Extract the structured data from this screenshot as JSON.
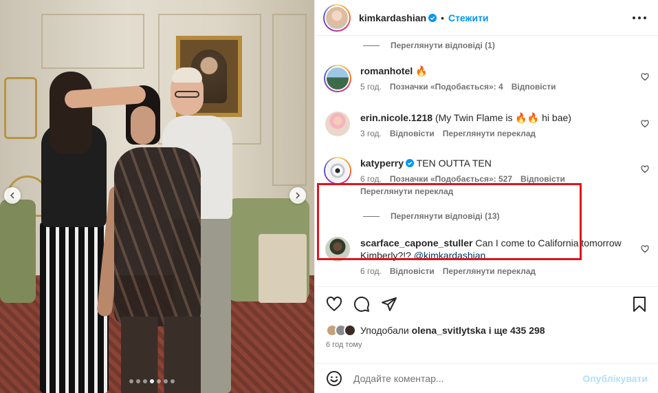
{
  "post": {
    "author": "kimkardashian",
    "separator": "•",
    "follow_label": "Стежити",
    "carousel": {
      "slide_count": 7,
      "active_index": 3
    }
  },
  "comments": {
    "top_replies": "Переглянути відповіді (1)",
    "items": [
      {
        "username": "romanhotel",
        "text": "🔥",
        "time": "5 год.",
        "likes": "Позначки «Подобається»: 4",
        "reply": "Відповісти"
      },
      {
        "username": "erin.nicole.1218",
        "text": "(My Twin Flame is 🔥🔥 hi bae)",
        "time": "3 год.",
        "reply": "Відповісти",
        "translate": "Переглянути переклад"
      },
      {
        "username": "katyperry",
        "verified": true,
        "text": "TEN OUTTA TEN",
        "time": "6 год.",
        "likes": "Позначки «Подобається»: 527",
        "reply": "Відповісти",
        "translate": "Переглянути переклад",
        "replies": "Переглянути відповіді (13)"
      },
      {
        "username": "scarface_capone_stuller",
        "text": "Can I come to California tomorrow Kimberly?!?",
        "mention": "@kimkardashian",
        "time": "6 год.",
        "reply": "Відповісти",
        "translate": "Переглянути переклад"
      }
    ]
  },
  "actions": {
    "liked_by_prefix": "Уподобали",
    "liked_by_user": "olena_svitlytska",
    "liked_by_suffix": "і ще 435 298",
    "time_ago": "6 год тому"
  },
  "composer": {
    "placeholder": "Додайте коментар...",
    "post_label": "Опублікувати"
  },
  "colors": {
    "accent": "#0095f6",
    "highlight": "#e0131a",
    "post_disabled": "#b2dffc"
  }
}
